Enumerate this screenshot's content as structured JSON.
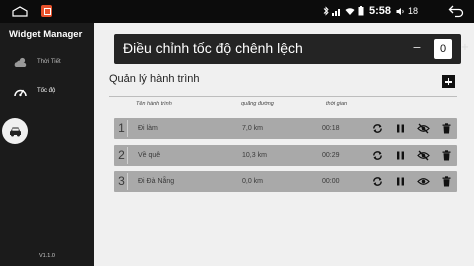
{
  "status_bar": {
    "time": "5:58",
    "volume": "18"
  },
  "sidebar": {
    "app_title": "Widget Manager",
    "items": [
      {
        "label": "Thời Tiết",
        "icon": "cloud-icon"
      },
      {
        "label": "Tốc độ",
        "icon": "speedometer-icon"
      }
    ],
    "active_tab_icon": "car-icon",
    "version": "V1.1.0"
  },
  "speed_adjust": {
    "title": "Điều chỉnh tốc độ chênh lệch",
    "minus": "−",
    "value": "0",
    "plus": "+"
  },
  "trips": {
    "title": "Quản lý hành trình",
    "columns": [
      "Tên hành trình",
      "quãng đường",
      "thời gian"
    ],
    "rows": [
      {
        "num": "1",
        "name": "Đi làm",
        "distance": "7,0 km",
        "time": "00:18",
        "visibility_icon": "eye-off-icon"
      },
      {
        "num": "2",
        "name": "Về quê",
        "distance": "10,3 km",
        "time": "00:29",
        "visibility_icon": "eye-off-icon"
      },
      {
        "num": "3",
        "name": "Đi Đà Nẵng",
        "distance": "0,0 km",
        "time": "00:00",
        "visibility_icon": "eye-icon"
      }
    ]
  },
  "colors": {
    "sidebar_bg": "#1b1b1b",
    "panel_bg": "#242424",
    "row_bg": "#a9a9a9",
    "main_bg": "#f0f0f0",
    "app_icon": "#e8522c"
  }
}
